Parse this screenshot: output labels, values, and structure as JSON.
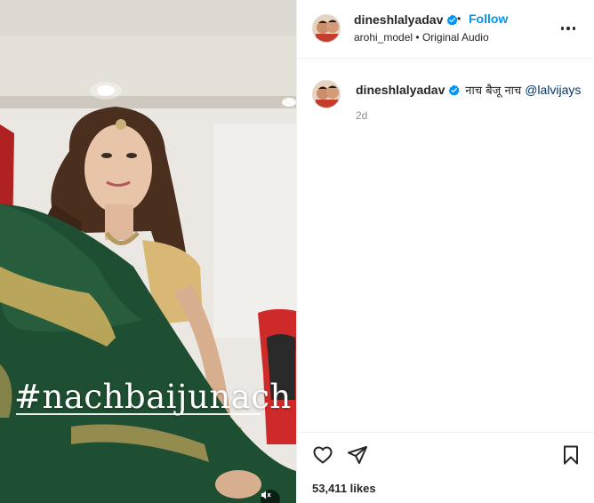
{
  "post": {
    "media": {
      "hashtag_overlay": "#nachbaijunach",
      "icons": {
        "mute": "mute-icon"
      }
    },
    "header": {
      "username": "dineshlalyadav",
      "verified_icon": "verified-badge-icon",
      "separator": "•",
      "follow_label": "Follow",
      "audio_user": "arohi_model",
      "audio_separator": "•",
      "audio_label": "Original Audio",
      "more_icon": "more-options-icon"
    },
    "caption": {
      "username": "dineshlalyadav",
      "text": "नाच बैजू नाच",
      "mention": "@lalvijays",
      "timestamp": "2d"
    },
    "actions": {
      "like_icon": "heart-icon",
      "share_icon": "send-icon",
      "save_icon": "bookmark-icon",
      "likes_count": "53,411",
      "likes_suffix": "likes"
    },
    "colors": {
      "follow_blue": "#0095f6",
      "verified_blue": "#0095f6",
      "mention_navy": "#00376b",
      "muted_gray": "#8e8e8e",
      "border": "#efefef"
    }
  }
}
